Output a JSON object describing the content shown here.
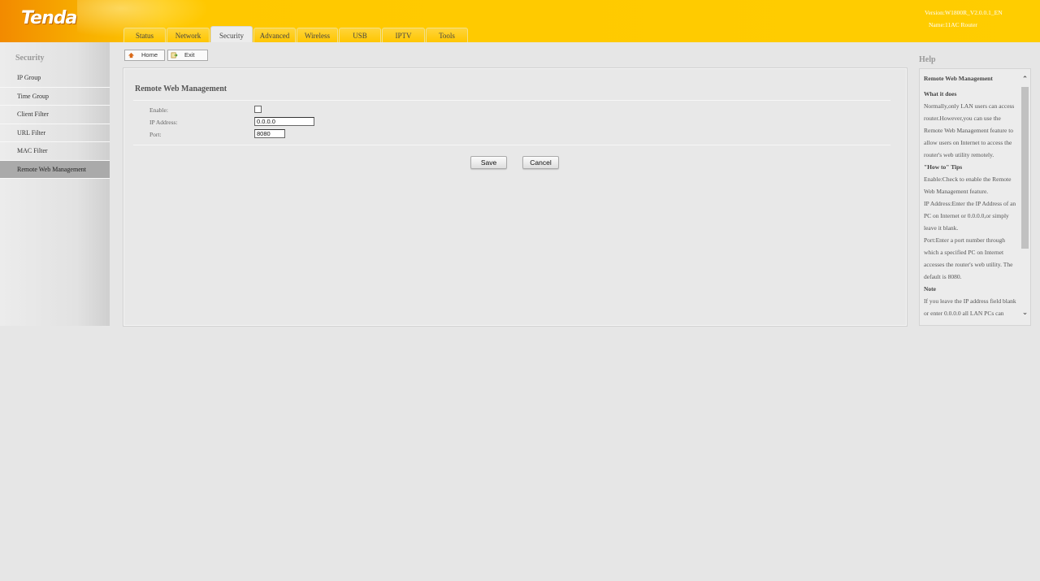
{
  "header": {
    "logo": "Tenda",
    "version": "Version:W1800R_V2.0.0.1_EN",
    "name": "Name:11AC Router",
    "tabs": [
      {
        "label": "Status",
        "active": false
      },
      {
        "label": "Network",
        "active": false
      },
      {
        "label": "Security",
        "active": true
      },
      {
        "label": "Advanced",
        "active": false
      },
      {
        "label": "Wireless",
        "active": false
      },
      {
        "label": "USB",
        "active": false
      },
      {
        "label": "IPTV",
        "active": false
      },
      {
        "label": "Tools",
        "active": false
      }
    ]
  },
  "sidebar": {
    "title": "Security",
    "items": [
      {
        "label": "IP Group"
      },
      {
        "label": "Time Group"
      },
      {
        "label": "Client Filter"
      },
      {
        "label": "URL Filter"
      },
      {
        "label": "MAC Filter"
      },
      {
        "label": "Remote Web Management",
        "active": true
      }
    ]
  },
  "toolbar": {
    "home_label": "Home",
    "exit_label": "Exit"
  },
  "main": {
    "title": "Remote Web Management",
    "enable_label": "Enable:",
    "enable_checked": false,
    "ip_label": "IP Address:",
    "ip_value": "0.0.0.0",
    "port_label": "Port:",
    "port_value": "8080",
    "save_label": "Save",
    "cancel_label": "Cancel"
  },
  "help": {
    "title": "Help",
    "heading": "Remote Web Management",
    "what_title": "What it does",
    "what_text": "Normally,only LAN users can access router.However,you can use the Remote Web Management feature to allow users on Internet to access the router's web utility remotely.",
    "howto_title": "\"How to\" Tips",
    "howto_enable": "Enable:Check to enable the Remote Web Management feature.",
    "howto_ip": "IP Address:Enter the IP Address of an PC on Internet or 0.0.0.0,or simply leave it blank.",
    "howto_port": "Port:Enter a port number through which a specified PC on Internet accesses the router's web utility. The default is 8080.",
    "note_title": "Note",
    "note_text": "If you leave the IP address field blank or enter 0.0.0.0 all LAN PCs can"
  },
  "colors": {
    "header_orange": "#f28a00",
    "header_yellow": "#ffcd00",
    "active_side": "#aaaaaa"
  }
}
